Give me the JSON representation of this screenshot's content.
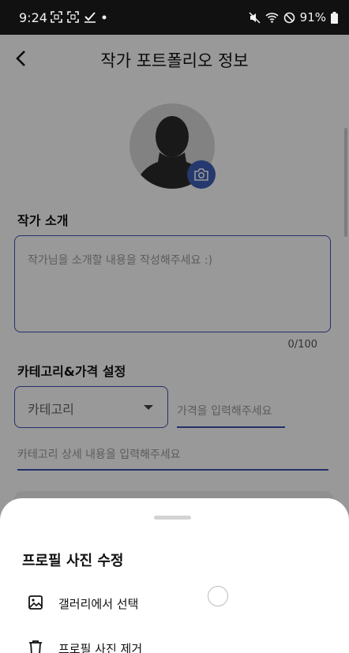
{
  "status_bar": {
    "time": "9:24",
    "battery": "91%",
    "left_icons": [
      "screenshot-icon",
      "screenshot-icon",
      "check-icon",
      "dot-icon"
    ],
    "right_icons": [
      "mute-icon",
      "wifi-icon",
      "do-not-disturb-icon",
      "battery-icon"
    ]
  },
  "app_bar": {
    "title": "작가 포트폴리오 정보"
  },
  "intro": {
    "label": "작가 소개",
    "placeholder": "작가님을 소개할 내용을 작성해주세요 :)",
    "counter": "0/100"
  },
  "category": {
    "label": "카테고리&가격 설정",
    "select_value": "카테고리",
    "price_placeholder": "가격을 입력해주세요",
    "detail_placeholder": "카테고리 상세 내용을 입력해주세요"
  },
  "bottom_sheet": {
    "title": "프로필 사진 수정",
    "items": [
      {
        "label": "갤러리에서 선택",
        "icon": "image-icon"
      },
      {
        "label": "프로필 사진 제거",
        "icon": "trash-icon"
      }
    ]
  },
  "colors": {
    "accent": "#3f51b5",
    "camera_button": "#3f5fb8",
    "scrim": "rgba(0,0,0,0.40)"
  }
}
